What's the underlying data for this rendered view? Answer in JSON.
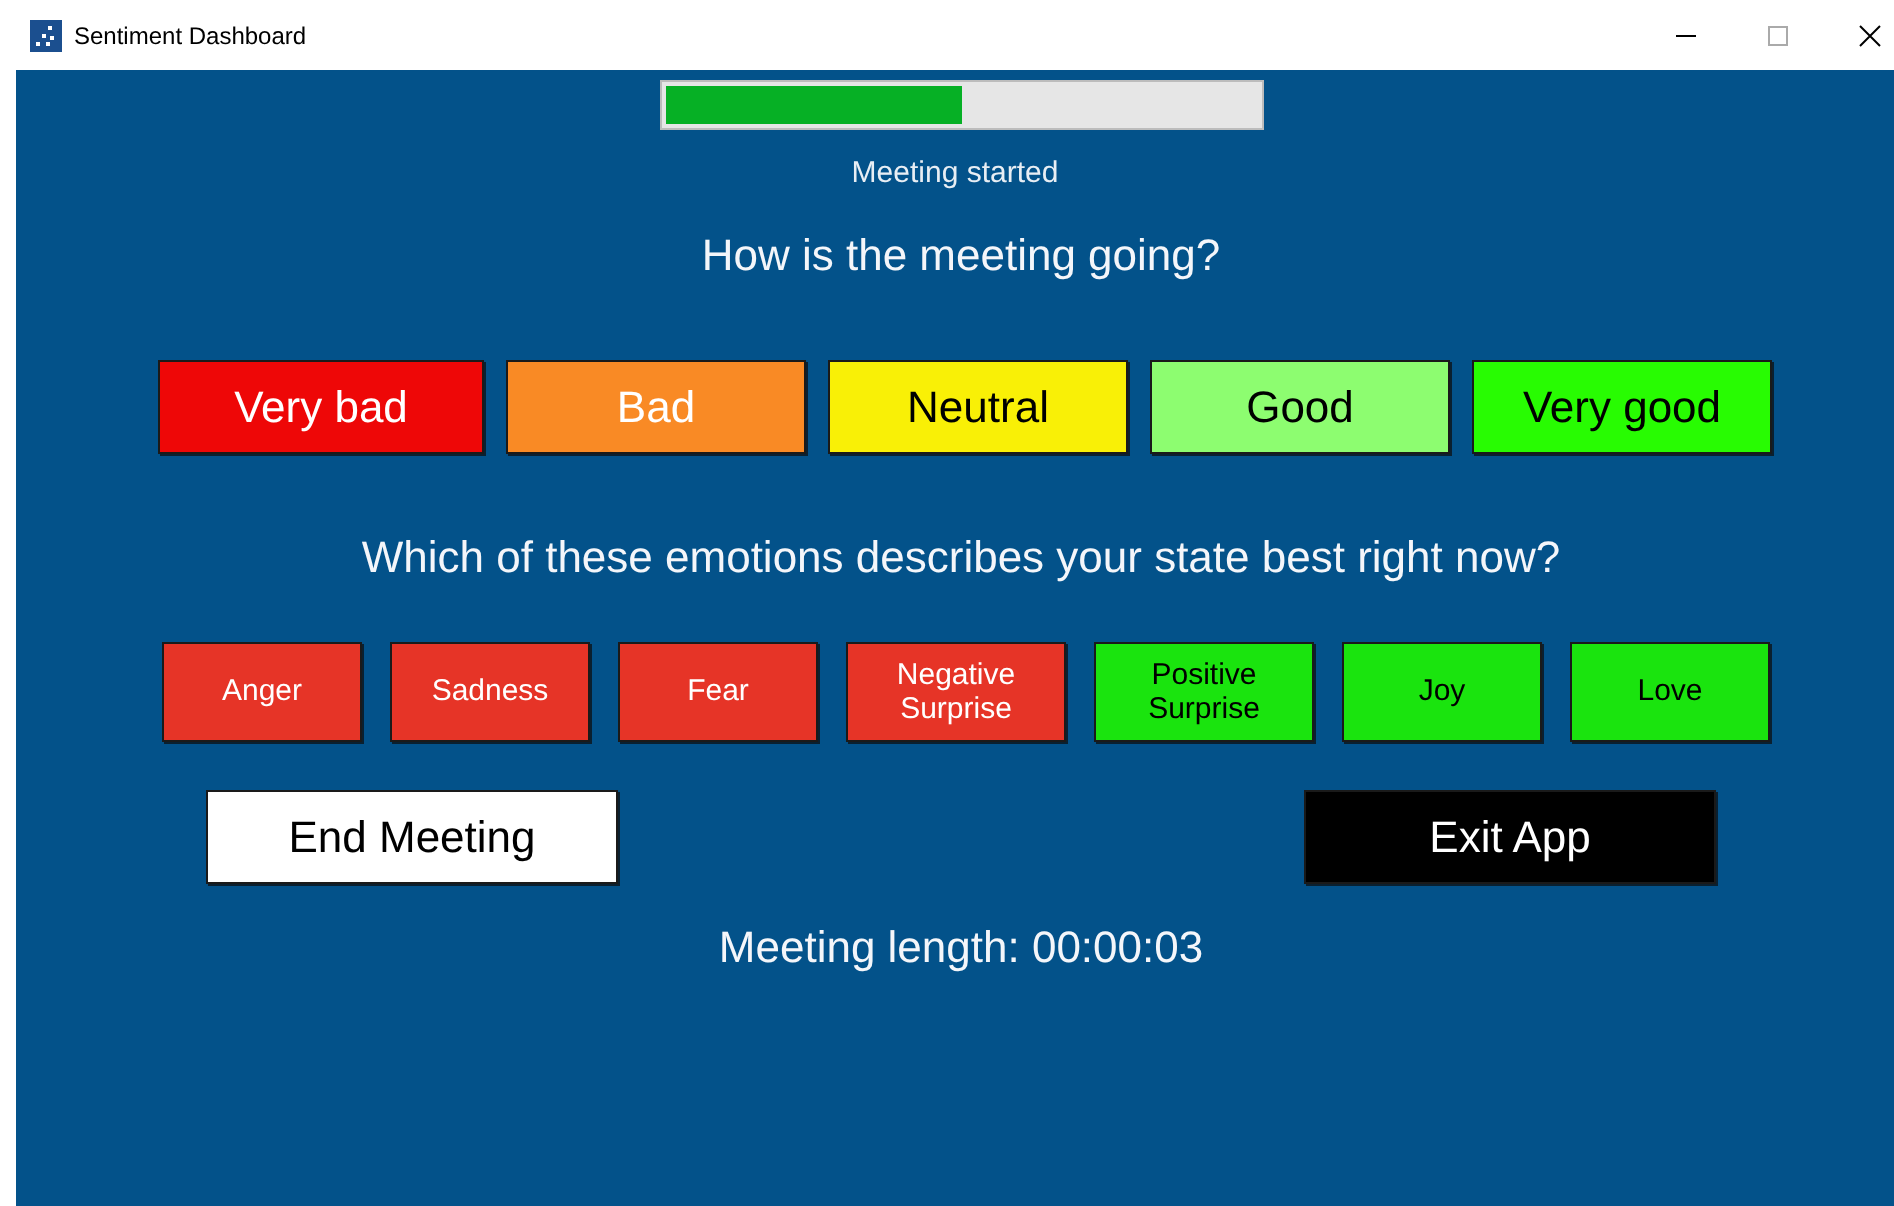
{
  "window": {
    "title": "Sentiment Dashboard"
  },
  "progress": {
    "level": 0.5
  },
  "status": "Meeting started",
  "rating_question": "How is the meeting going?",
  "ratings": [
    {
      "label": "Very bad",
      "color": "#ee0707",
      "kind": "lighttext"
    },
    {
      "label": "Bad",
      "color": "#f98a25",
      "kind": "lighttext"
    },
    {
      "label": "Neutral",
      "color": "#f9f006",
      "kind": "darktext"
    },
    {
      "label": "Good",
      "color": "#8dfd70",
      "kind": "darktext"
    },
    {
      "label": "Very good",
      "color": "#28fc02",
      "kind": "darktext"
    }
  ],
  "emotion_question": "Which of these emotions describes your state best right now?",
  "emotions": [
    {
      "label": "Anger",
      "color": "#e63427",
      "kind": "lighttext"
    },
    {
      "label": "Sadness",
      "color": "#e63427",
      "kind": "lighttext"
    },
    {
      "label": "Fear",
      "color": "#e63427",
      "kind": "lighttext"
    },
    {
      "label": "Negative\nSurprise",
      "color": "#e63427",
      "kind": "lighttext"
    },
    {
      "label": "Positive\nSurprise",
      "color": "#1ae40e",
      "kind": "darktext"
    },
    {
      "label": "Joy",
      "color": "#1ae40e",
      "kind": "darktext"
    },
    {
      "label": "Love",
      "color": "#1ae40e",
      "kind": "darktext"
    }
  ],
  "actions": [
    {
      "label": "End Meeting",
      "kind": "light"
    },
    {
      "label": "Exit App",
      "kind": "dark"
    }
  ],
  "meeting_length": "Meeting length: 00:00:03"
}
